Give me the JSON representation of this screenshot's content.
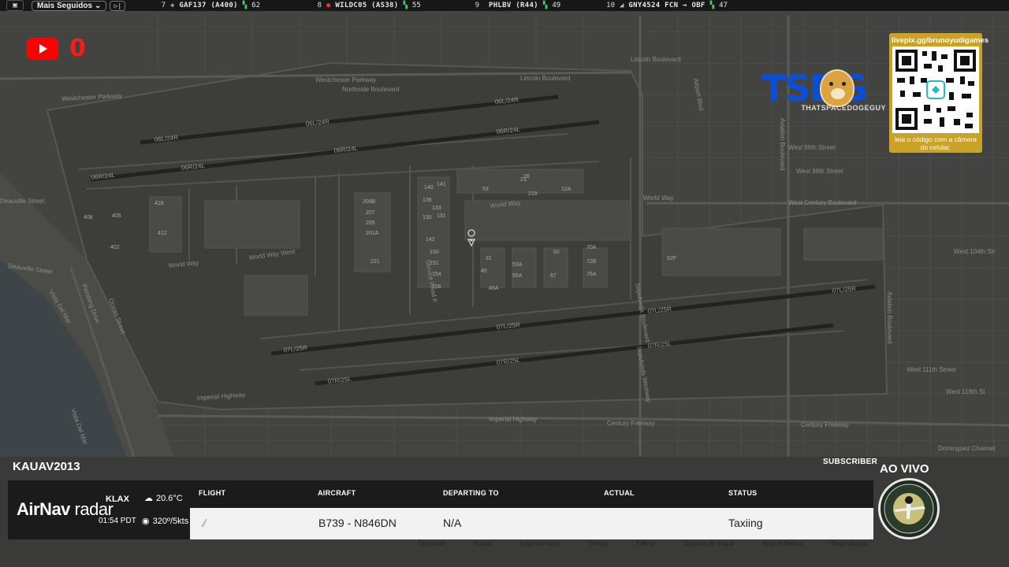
{
  "topbar": {
    "menu_icon": "menu-icon",
    "following_label": "Mais Seguidos",
    "flights": [
      {
        "rank": "7",
        "callsign": "GAF137 (A400)",
        "viewers": "62"
      },
      {
        "rank": "8",
        "callsign": "WILDC05 (AS38)",
        "viewers": "55"
      },
      {
        "rank": "9",
        "callsign": "PHLBV (R44)",
        "viewers": "49"
      },
      {
        "rank": "10",
        "callsign": "GNY4524 FCN → OBF",
        "viewers": "47"
      }
    ]
  },
  "map": {
    "labels": {
      "westchester_pkwy": "Westchester Parkway",
      "westchester_pkwy2": "Westchester Parkway",
      "northside": "Northside Boulevard",
      "lincoln": "Lincoln Boulevard",
      "world_way": "World Way",
      "world_way_west": "World Way West",
      "world_way2": "World Way",
      "century_blvd": "West Century Boulevard",
      "w98": "West 98th Street",
      "w104": "West 104th Str",
      "w111": "West 111th Street",
      "w119": "West 119th St",
      "imperial": "Imperial Highway",
      "century_fwy": "Century Freeway",
      "dominguez": "Dominguez Channel",
      "pershing": "Pershing Drive",
      "vista_del_mar": "Vista Del Mar",
      "ocean_st": "Ocean Street",
      "beauville": "Deauville Street",
      "aviation": "Aviation Boulevard",
      "sepulveda": "Sepulveda Boulevard",
      "service_road": "Service Road K",
      "airport_blvd": "Airport Blvd",
      "wst": "West 96th Street",
      "rwy_06l24r": "06L/24R",
      "rwy_06r24l": "06R/24L",
      "rwy_07l25r": "07L/25R",
      "rwy_07r25l": "07R/25L",
      "sepulveda_west": "Sepulveda Westway",
      "vista_del_mar2": "Vista Del Mar"
    },
    "gates": [
      "408",
      "405",
      "402",
      "418",
      "412",
      "209B",
      "207",
      "205",
      "201A",
      "221",
      "140",
      "142",
      "150",
      "151",
      "154",
      "156",
      "136",
      "133",
      "130",
      "141",
      "131",
      "53",
      "23",
      "28",
      "218",
      "12A",
      "31",
      "45",
      "46A",
      "53A",
      "55A",
      "60",
      "67",
      "70A",
      "72B",
      "76A",
      "52F"
    ]
  },
  "overlay": {
    "youtube_count": "0",
    "brand_text": "TSDG",
    "brand_sub": "THATSPACEDOGEGUY",
    "qr_top": "livepix.gg/brunoyudigames",
    "qr_caption": "leia o código com a câmera do celular."
  },
  "panel": {
    "username": "KAUAV2013",
    "subscriber": "SUBSCRIBER",
    "live": "AO VIVO",
    "brand_bold": "AirNav",
    "brand_light": " radar",
    "airport": "KLAX",
    "time": "01:54 PDT",
    "temp": "20.6°C",
    "wind": "320º/5kts",
    "headers": {
      "flight": "FLIGHT",
      "aircraft": "AIRCRAFT",
      "departing": "DEPARTING TO",
      "actual": "ACTUAL",
      "status": "STATUS"
    },
    "row": {
      "flight": "",
      "aircraft": "B739 - N846DN",
      "departing": "N/A",
      "actual": "",
      "status": "Taxiing"
    },
    "menu": [
      "Desl.com",
      "Radio",
      "Lista de voos",
      "Tempo",
      "Filtros",
      "Opções de mapa",
      "Airport Select",
      "Reprodução"
    ]
  }
}
